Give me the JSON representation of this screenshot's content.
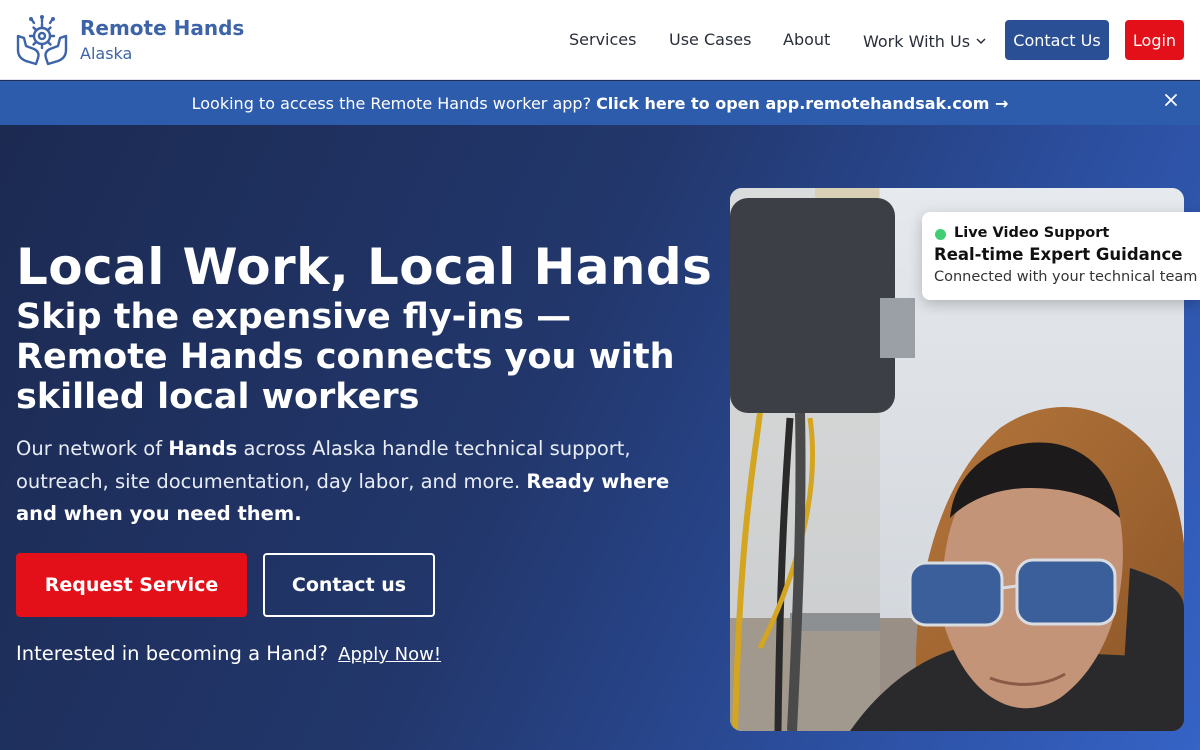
{
  "brand": {
    "title": "Remote Hands",
    "subtitle": "Alaska",
    "color": "#3d64a8"
  },
  "nav": {
    "items": [
      {
        "label": "Services"
      },
      {
        "label": "Use Cases"
      },
      {
        "label": "About"
      },
      {
        "label": "Work With Us",
        "icon": "chevron-down-icon"
      }
    ],
    "contact_label": "Contact Us",
    "login_label": "Login"
  },
  "banner": {
    "text": "Looking to access the Remote Hands worker app?",
    "link": "Click here to open app.remotehandsak.com →",
    "close_icon": "close-icon"
  },
  "hero": {
    "heading": "Local Work, Local Hands",
    "subheading": "Skip the expensive fly-ins — Remote Hands connects you with skilled local workers",
    "lead": {
      "p1": "Our network of ",
      "b1": "Hands",
      "p2": " across Alaska handle technical support, outreach, site documentation, day labor, and more. ",
      "b2": "Ready where and when you need them."
    },
    "primary_cta": "Request Service",
    "secondary_cta": "Contact us",
    "apply_prompt": "Interested in becoming a Hand?",
    "apply_link": "Apply Now!"
  },
  "live_card": {
    "status": "Live Video Support",
    "title": "Real-time Expert Guidance",
    "subtitle": "Connected with your technical team",
    "status_color": "#3fcf72"
  },
  "colors": {
    "primary_blue": "#2a4f94",
    "accent_red": "#e3101a",
    "banner_blue": "#2d5cad",
    "hero_dark": "#1c2a52"
  }
}
